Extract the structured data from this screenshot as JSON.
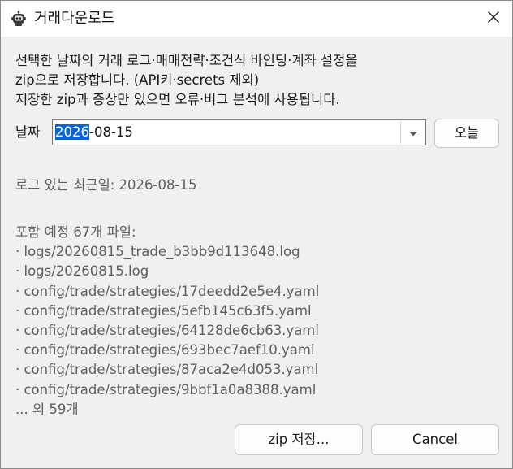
{
  "window": {
    "title": "거래다운로드",
    "icon": "robot-icon",
    "close_icon": "close-icon"
  },
  "description": {
    "line1": "선택한 날짜의 거래 로그·매매전략·조건식 바인딩·계좌 설정을",
    "line2": "zip으로 저장합니다. (API키·secrets 제외)",
    "line3": "저장한 zip과 증상만 있으면 오류·버그 분석에 사용됩니다."
  },
  "date_picker": {
    "label": "날짜",
    "value_selected": "2026",
    "value_rest": "-08-15",
    "today_button": "오늘",
    "arrow_icon": "chevron-down-icon"
  },
  "recent_log": {
    "text": "로그 있는 최근일: 2026-08-15"
  },
  "files": {
    "header": "포함 예정 67개 파일:",
    "items": [
      "· logs/20260815_trade_b3bb9d113648.log",
      "· logs/20260815.log",
      "· config/trade/strategies/17deedd2e5e4.yaml",
      "· config/trade/strategies/5efb145c63f5.yaml",
      "· config/trade/strategies/64128de6cb63.yaml",
      "· config/trade/strategies/693bec7aef10.yaml",
      "· config/trade/strategies/87aca2e4d053.yaml",
      "· config/trade/strategies/9bbf1a0a8388.yaml"
    ],
    "more": "... 외 59개"
  },
  "footer": {
    "zip_button": "zip 저장...",
    "cancel_button": "Cancel"
  },
  "colors": {
    "selection": "#0a64d6",
    "background": "#f0f0f0",
    "muted_text": "#5f5f5f"
  }
}
